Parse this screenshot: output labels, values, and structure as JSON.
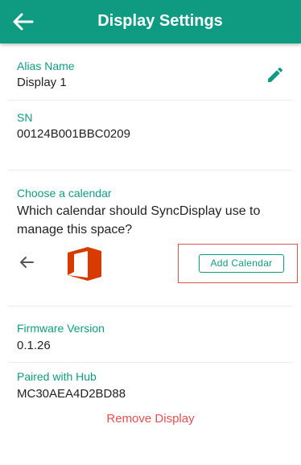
{
  "header": {
    "title": "Display Settings"
  },
  "alias": {
    "label": "Alias Name",
    "value": "Display 1"
  },
  "sn": {
    "label": "SN",
    "value": "00124B001BBC0209"
  },
  "calendar": {
    "label": "Choose a calendar",
    "question": "Which calendar should SyncDisplay use to manage this space?",
    "provider_icon": "office-365-icon",
    "add_button": "Add Calendar"
  },
  "firmware": {
    "label": "Firmware Version",
    "value": "0.1.26"
  },
  "hub": {
    "label": "Paired with Hub",
    "value": "MC30AEA4D2BD88"
  },
  "actions": {
    "remove": "Remove Display"
  },
  "colors": {
    "primary": "#0f9b82",
    "danger": "#e2504f",
    "office": "#d83b01"
  }
}
